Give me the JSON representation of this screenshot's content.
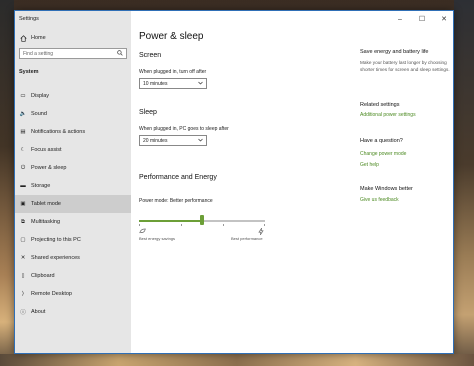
{
  "window": {
    "title": "Settings"
  },
  "controls": {
    "minimize": "–",
    "maximize": "☐",
    "close": "✕"
  },
  "sidebar": {
    "home_label": "Home",
    "search_placeholder": "Find a setting",
    "section": "System",
    "items": [
      {
        "label": "Display",
        "icon": "display-icon",
        "glyph": "▭"
      },
      {
        "label": "Sound",
        "icon": "sound-icon",
        "glyph": "🔈"
      },
      {
        "label": "Notifications & actions",
        "icon": "notifications-icon",
        "glyph": "▤"
      },
      {
        "label": "Focus assist",
        "icon": "focus-assist-icon",
        "glyph": "☾"
      },
      {
        "label": "Power & sleep",
        "icon": "power-icon",
        "glyph": "⏻"
      },
      {
        "label": "Storage",
        "icon": "storage-icon",
        "glyph": "▬"
      },
      {
        "label": "Tablet mode",
        "icon": "tablet-mode-icon",
        "glyph": "▣"
      },
      {
        "label": "Multitasking",
        "icon": "multitasking-icon",
        "glyph": "⧉"
      },
      {
        "label": "Projecting to this PC",
        "icon": "projecting-icon",
        "glyph": "▢"
      },
      {
        "label": "Shared experiences",
        "icon": "shared-experiences-icon",
        "glyph": "✕"
      },
      {
        "label": "Clipboard",
        "icon": "clipboard-icon",
        "glyph": "▯"
      },
      {
        "label": "Remote Desktop",
        "icon": "remote-desktop-icon",
        "glyph": "⟩"
      },
      {
        "label": "About",
        "icon": "about-icon",
        "glyph": "ⓘ"
      }
    ],
    "active_index": 6
  },
  "main": {
    "title": "Power & sleep",
    "screen": {
      "heading": "Screen",
      "label": "When plugged in, turn off after",
      "value": "10 minutes"
    },
    "sleep": {
      "heading": "Sleep",
      "label": "When plugged in, PC goes to sleep after",
      "value": "20 minutes"
    },
    "performance": {
      "heading": "Performance and Energy",
      "mode_label": "Power mode: Better performance",
      "slider_position_fraction": 0.5,
      "left_caption": "Best energy savings",
      "right_caption": "Best performance"
    }
  },
  "right": {
    "save_heading": "Save energy and battery life",
    "save_text": "Make your battery last longer by choosing shorter times for screen and sleep settings.",
    "related_heading": "Related settings",
    "related_link": "Additional power settings",
    "question_heading": "Have a question?",
    "question_links": [
      "Change power mode",
      "Get help"
    ],
    "better_heading": "Make Windows better",
    "better_link": "Give us feedback"
  },
  "colors": {
    "accent": "#6c9f37",
    "link": "#4c8a22",
    "sidebar": "#e6e6e6",
    "active": "#cdcdcd"
  }
}
